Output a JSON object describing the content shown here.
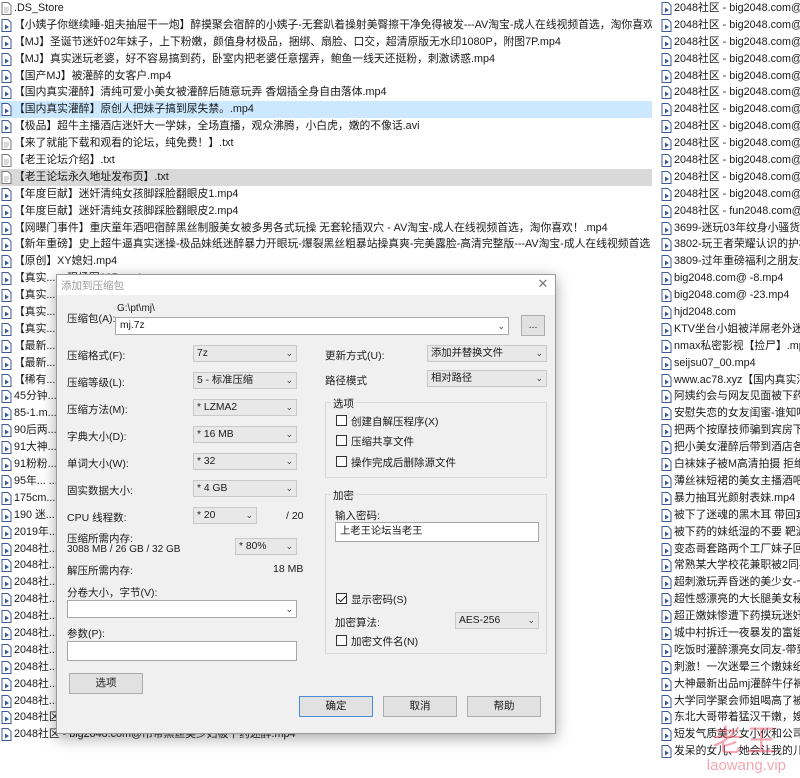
{
  "file_list": {
    "col1": [
      ".DS_Store",
      "【小姨子你继续睡-姐夫抽屉干一炮】醉摸聚会宿醉的小姨子-无套趴着操射美臀擦干净免得被发---AV淘宝-成人在线视频首选，淘你喜欢！.mp4",
      "【MJ】圣诞节迷奸02年妹子，上下粉嫩，颜值身材极品，捆绑、扇脸、口交，超清原版无水印1080P，附图7P.mp4",
      "【MJ】真实迷玩老婆，好不容易搞到药，卧室内把老婆任意摆弄，鲍鱼一线天还挺粉，刺激诱惑.mp4",
      "【国产MJ】被灌醉的女客户.mp4",
      "【国内真实灌醉】清纯可爱小美女被灌醉后随意玩弄 香烟插全身自由落体.mp4",
      "【国内真实灌醉】原创人把妹子搞到尿失禁。.mp4",
      "【极品】超牛主播酒店迷奸大一学妹，全场直播，观众沸腾，小白虎，嫩的不像话.avi",
      "【来了就能下载和观看的论坛，纯免费！】.txt",
      "【老王论坛介绍】.txt",
      "【老王论坛永久地址发布页】.txt",
      "【年度巨献】迷奸清纯女孩脚踩脸翻眼皮1.mp4",
      "【年度巨献】迷奸清纯女孩脚踩脸翻眼皮2.mp4",
      "【网曝门事件】重庆童年酒吧宿醉黑丝制服美女被多男各式玩操 无套轮插双穴 - AV淘宝-成人在线视频首选，淘你喜欢！.mp4",
      "【新年重磅】史上超牛逼真实迷操-极品妹纸迷醉暴力开眼玩-爆裂黑丝粗暴站操真爽-完美露脸-高清完整版---AV淘宝-成人在线视频首选，淘你...",
      "【原创】XY媳妇.mp4",
      "【真实...  ...现场图10P.mp4",
      "【真实...",
      "【真实...",
      "【真实...",
      "【最新...  ...淘你喜欢！.mp4",
      "【最新...  ...成人在线视频首选，淘你喜...",
      "【稀有...",
      "45分钟...  ....mp4",
      "85-1.m...",
      "90后两...  ...成人在线视频首选...",
      "91大神...",
      "91粉粉...",
      "95年...  ...AV淘宝-成人在线视频首选...",
      "175cm...",
      "190 迷...",
      "2019年...",
      "2048社...  ...秒藏.mp4",
      "2048社...",
      "2048社...",
      "2048社...",
      "2048社...",
      "2048社...",
      "2048社...",
      "2048社...",
      "2048社...",
      "2048社...  ...无套内射真实刺激...",
      "2048社区 - big2048.com@大奶美少妇贪杯酒醉后被带至酒店惨遭爆操.mp4",
      "2048社区 - big2048.com@吊带黑丝美少妇被下药迷醉.mp4"
    ],
    "col2": [
      "2048社区 - big2048.com@...",
      "2048社区 - big2048.com@...",
      "2048社区 - big2048.com@...",
      "2048社区 - big2048.com@...",
      "2048社区 - big2048.com@...",
      "2048社区 - big2048.com@...",
      "2048社区 - big2048.com@...",
      "2048社区 - big2048.com@...",
      "2048社区 - big2048.com@...",
      "2048社区 - big2048.com@...",
      "2048社区 - big2048.com@...",
      "2048社区 - big2048.com@...",
      "2048社区 - fun2048.com@...",
      "3699-迷玩03年纹身小骚货 扣...",
      "3802-玩王者荣耀认识的护校小...",
      "3809-过年重磅福利之朋友最新...",
      "big2048.com@ -8.mp4",
      "big2048.com@ -23.mp4",
      "hjd2048.com",
      "KTV坐台小姐被洋屌老外迷药...",
      "nmax私密影视【捡尸】.mp4",
      "seijsu07_00.mp4",
      "www.ac78.xyz【国内真实灌醉...",
      "阿姨约会与网友见面被下药迷...",
      "安慰失恋的女友闺蜜-谁知喝多...",
      "把两个按摩技师骗到宾房下药...",
      "把小美女灌醉后带到酒店各种...",
      "白袜妹子被M高清拍摄 拒绝音...",
      "薄丝袜短裙的美女主播酒吧醉...",
      "暴力抽耳光颜射表妹.mp4",
      "被下了迷魂的黑木耳 带回宾馆...",
      "被下药的妹纸湿的不要 靶波的...",
      "变态哥套路两个工厂妹子回家...",
      "常熟某大学校花兼职被2同事下...",
      "超刺激玩弄昏迷的美少女-一边...",
      "超性感漂亮的大长腿美女秘书...",
      "超正嫩妹惨遭下药摸玩迷奸.m...",
      "城中村拆迁一夜暴发的富姐酒...",
      "吃饭时灌醉漂亮女同友-带到酒...",
      "刺激！一次迷晕三个嫩妹纸-看...",
      "大神最新出品mj灌醉牛仔裤白...",
      "大学同学聚会师姐喝高了被带...",
      "东北大哥带着猛汉干嫩，嫂子...",
      "短发气质美少女小伙和公司聚会...",
      "发呆的女儿、她会让我的儿子..."
    ],
    "selected_index": 6,
    "highlight_index": 10
  },
  "watermark": {
    "big": "老王",
    "small": "laowang.vip"
  },
  "dialog": {
    "title": "添加到压缩包",
    "close": "✕",
    "archive": {
      "label": "压缩包(A):",
      "path": "G:\\pt\\mj\\",
      "filename": "mj.7z",
      "browse": "..."
    },
    "format": {
      "label": "压缩格式(F):",
      "value": "7z"
    },
    "level": {
      "label": "压缩等级(L):",
      "value": "5 - 标准压缩"
    },
    "method": {
      "label": "压缩方法(M):",
      "value": "* LZMA2"
    },
    "dict": {
      "label": "字典大小(D):",
      "value": "* 16 MB"
    },
    "word": {
      "label": "单词大小(W):",
      "value": "* 32"
    },
    "solid": {
      "label": "固实数据大小:",
      "value": "* 4 GB"
    },
    "threads": {
      "label": "CPU 线程数:",
      "value": "* 20",
      "max": "/ 20"
    },
    "mem_compress": {
      "label": "压缩所需内存:",
      "detail": "3088 MB / 26 GB / 32 GB",
      "value": "* 80%"
    },
    "mem_decompress": {
      "label": "解压所需内存:",
      "value": "18 MB"
    },
    "split": {
      "label": "分卷大小，字节(V):",
      "value": ""
    },
    "params": {
      "label": "参数(P):",
      "value": ""
    },
    "options_btn": "选项",
    "update": {
      "label": "更新方式(U):",
      "value": "添加并替换文件"
    },
    "pathmode": {
      "label": "路径模式",
      "value": "相对路径"
    },
    "options_group": {
      "title": "选项",
      "sfx": {
        "label": "创建自解压程序(X)",
        "checked": false
      },
      "shared": {
        "label": "压缩共享文件",
        "checked": false
      },
      "delete": {
        "label": "操作完成后删除源文件",
        "checked": false
      }
    },
    "encryption": {
      "title": "加密",
      "password_label": "输入密码:",
      "password": "上老王论坛当老王",
      "show_password": {
        "label": "显示密码(S)",
        "checked": true
      },
      "method_label": "加密算法:",
      "method": "AES-256",
      "encrypt_names": {
        "label": "加密文件名(N)",
        "checked": false
      }
    },
    "buttons": {
      "ok": "确定",
      "cancel": "取消",
      "help": "帮助"
    }
  }
}
